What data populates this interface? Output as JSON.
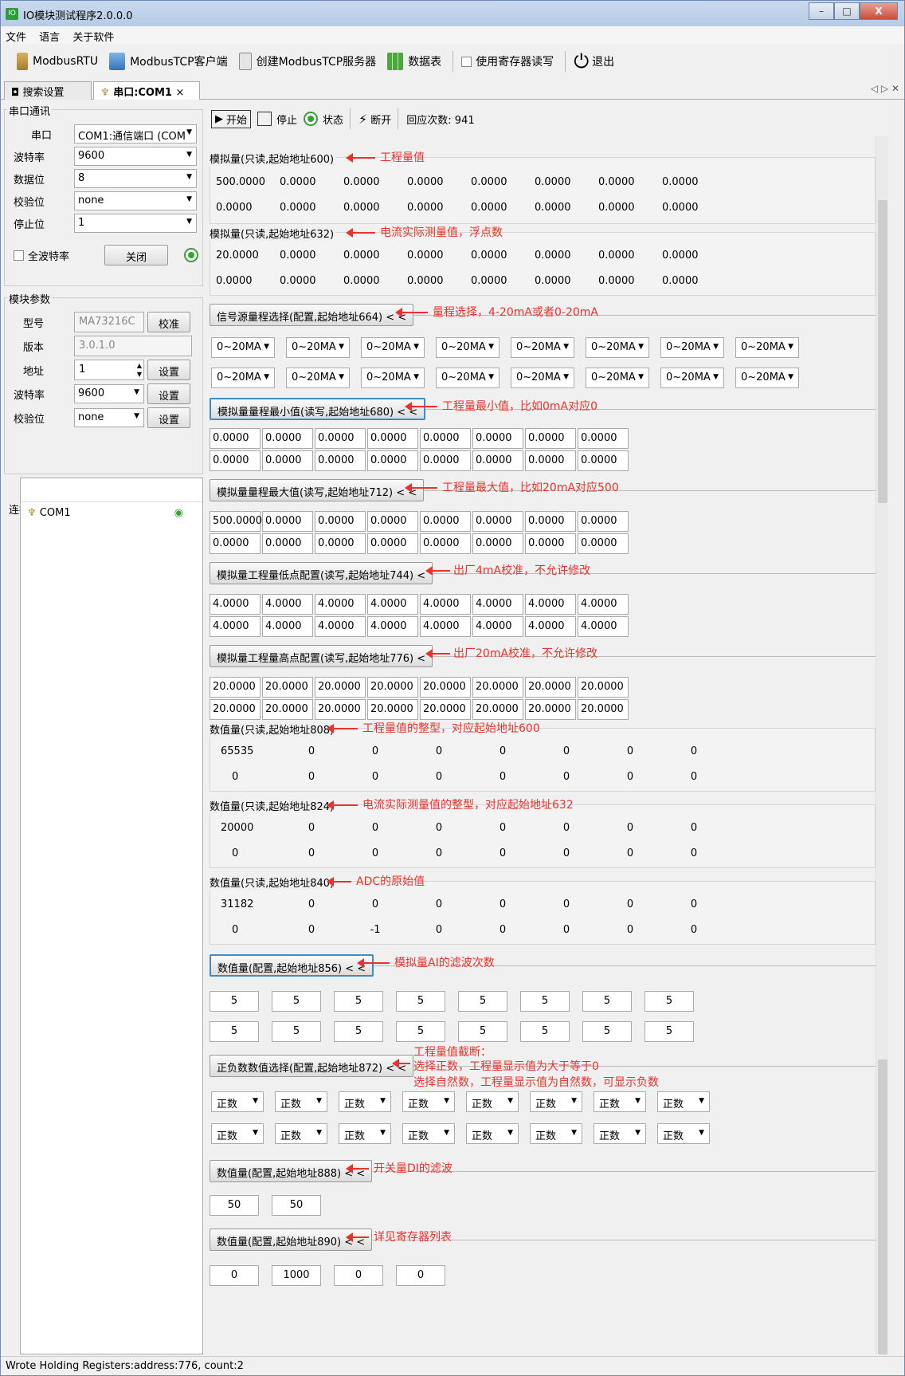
{
  "window": {
    "title": "IO模块测试程序2.0.0.0",
    "controls": [
      "–",
      "□",
      "X"
    ]
  },
  "menu": [
    "文件",
    "语言",
    "关于软件"
  ],
  "toolbar": {
    "modbus_rtu": "ModbusRTU",
    "modbus_tcp_client": "ModbusTCP客户端",
    "create_tcp_server": "创建ModbusTCP服务器",
    "data_table": "数据表",
    "use_register_rw": "使用寄存器读写",
    "exit": "退出"
  },
  "tabs": {
    "search": "搜索设置",
    "com1": "串口:COM1",
    "close": "×",
    "nav": "◁ ▷ ✕"
  },
  "serial": {
    "group_label": "串口通讯",
    "port_label": "串口",
    "port_value": "COM1:通信端口 (COM",
    "baud_label": "波特率",
    "baud_value": "9600",
    "databits_label": "数据位",
    "databits_value": "8",
    "parity_label": "校验位",
    "parity_value": "none",
    "stopbits_label": "停止位",
    "stopbits_value": "1",
    "all_baud_label": "全波特率",
    "close_button": "关闭"
  },
  "module": {
    "group_label": "模块参数",
    "model_label": "型号",
    "model_value": "MA73216C",
    "calibrate_button": "校准",
    "version_label": "版本",
    "version_value": "3.0.1.0",
    "address_label": "地址",
    "address_value": "1",
    "set_button": "设置",
    "baud_label": "波特率",
    "baud_value": "9600",
    "parity_label": "校验位",
    "parity_value": "none"
  },
  "connections": {
    "label": "连接列表",
    "items": [
      "COM1"
    ]
  },
  "run": {
    "start": "开始",
    "stop": "停止",
    "status": "状态",
    "disconnect": "断开",
    "response_count": "回应次数: 941"
  },
  "sections": {
    "s600": {
      "title": "模拟量(只读,起始地址600)",
      "note": "工程量值",
      "row1": [
        "500.0000",
        "0.0000",
        "0.0000",
        "0.0000",
        "0.0000",
        "0.0000",
        "0.0000",
        "0.0000"
      ],
      "row2": [
        "0.0000",
        "0.0000",
        "0.0000",
        "0.0000",
        "0.0000",
        "0.0000",
        "0.0000",
        "0.0000"
      ]
    },
    "s632": {
      "title": "模拟量(只读,起始地址632)",
      "note": "电流实际测量值，浮点数",
      "row1": [
        "20.0000",
        "0.0000",
        "0.0000",
        "0.0000",
        "0.0000",
        "0.0000",
        "0.0000",
        "0.0000"
      ],
      "row2": [
        "0.0000",
        "0.0000",
        "0.0000",
        "0.0000",
        "0.0000",
        "0.0000",
        "0.0000",
        "0.0000"
      ]
    },
    "s664": {
      "title": "信号源量程选择(配置,起始地址664) < <",
      "note": "量程选择，4-20mA或者0-20mA",
      "row1": [
        "0~20MA",
        "0~20MA",
        "0~20MA",
        "0~20MA",
        "0~20MA",
        "0~20MA",
        "0~20MA",
        "0~20MA"
      ],
      "row2": [
        "0~20MA",
        "0~20MA",
        "0~20MA",
        "0~20MA",
        "0~20MA",
        "0~20MA",
        "0~20MA",
        "0~20MA"
      ]
    },
    "s680": {
      "title": "模拟量量程最小值(读写,起始地址680) < <",
      "note": "工程量最小值，比如0mA对应0",
      "row1": [
        "0.0000",
        "0.0000",
        "0.0000",
        "0.0000",
        "0.0000",
        "0.0000",
        "0.0000",
        "0.0000"
      ],
      "row2": [
        "0.0000",
        "0.0000",
        "0.0000",
        "0.0000",
        "0.0000",
        "0.0000",
        "0.0000",
        "0.0000"
      ]
    },
    "s712": {
      "title": "模拟量量程最大值(读写,起始地址712) < <",
      "note": "工程量最大值，比如20mA对应500",
      "row1": [
        "500.0000",
        "0.0000",
        "0.0000",
        "0.0000",
        "0.0000",
        "0.0000",
        "0.0000",
        "0.0000"
      ],
      "row2": [
        "0.0000",
        "0.0000",
        "0.0000",
        "0.0000",
        "0.0000",
        "0.0000",
        "0.0000",
        "0.0000"
      ]
    },
    "s744": {
      "title": "模拟量工程量低点配置(读写,起始地址744) <",
      "note": "出厂4mA校准，不允许修改",
      "row1": [
        "4.0000",
        "4.0000",
        "4.0000",
        "4.0000",
        "4.0000",
        "4.0000",
        "4.0000",
        "4.0000"
      ],
      "row2": [
        "4.0000",
        "4.0000",
        "4.0000",
        "4.0000",
        "4.0000",
        "4.0000",
        "4.0000",
        "4.0000"
      ]
    },
    "s776": {
      "title": "模拟量工程量高点配置(读写,起始地址776) <",
      "note": "出厂20mA校准，不允许修改",
      "row1": [
        "20.0000",
        "20.0000",
        "20.0000",
        "20.0000",
        "20.0000",
        "20.0000",
        "20.0000",
        "20.0000"
      ],
      "row2": [
        "20.0000",
        "20.0000",
        "20.0000",
        "20.0000",
        "20.0000",
        "20.0000",
        "20.0000",
        "20.0000"
      ]
    },
    "s808": {
      "title": "数值量(只读,起始地址808)",
      "note": "工程量值的整型，对应起始地址600",
      "row1": [
        "65535",
        "0",
        "0",
        "0",
        "0",
        "0",
        "0",
        "0"
      ],
      "row2": [
        "0",
        "0",
        "0",
        "0",
        "0",
        "0",
        "0",
        "0"
      ]
    },
    "s824": {
      "title": "数值量(只读,起始地址824)",
      "note": "电流实际测量值的整型，对应起始地址632",
      "row1": [
        "20000",
        "0",
        "0",
        "0",
        "0",
        "0",
        "0",
        "0"
      ],
      "row2": [
        "0",
        "0",
        "0",
        "0",
        "0",
        "0",
        "0",
        "0"
      ]
    },
    "s840": {
      "title": "数值量(只读,起始地址840)",
      "note": "ADC的原始值",
      "row1": [
        "31182",
        "0",
        "0",
        "0",
        "0",
        "0",
        "0",
        "0"
      ],
      "row2": [
        "0",
        "0",
        "-1",
        "0",
        "0",
        "0",
        "0",
        "0"
      ]
    },
    "s856": {
      "title": "数值量(配置,起始地址856) < <",
      "note": "模拟量AI的滤波次数",
      "row1": [
        "5",
        "5",
        "5",
        "5",
        "5",
        "5",
        "5",
        "5"
      ],
      "row2": [
        "5",
        "5",
        "5",
        "5",
        "5",
        "5",
        "5",
        "5"
      ]
    },
    "s872": {
      "title": "正负数数值选择(配置,起始地址872) < <",
      "note1": "工程量值截断：",
      "note2": "选择正数，工程量显示值为大于等于0",
      "note3": "选择自然数，工程量显示值为自然数，可显示负数",
      "row1": [
        "正数",
        "正数",
        "正数",
        "正数",
        "正数",
        "正数",
        "正数",
        "正数"
      ],
      "row2": [
        "正数",
        "正数",
        "正数",
        "正数",
        "正数",
        "正数",
        "正数",
        "正数"
      ]
    },
    "s888": {
      "title": "数值量(配置,起始地址888) < <",
      "note": "开关量DI的滤波",
      "row1": [
        "50",
        "50"
      ]
    },
    "s890": {
      "title": "数值量(配置,起始地址890) < <",
      "note": "详见寄存器列表",
      "row1": [
        "0",
        "1000",
        "0",
        "0"
      ]
    }
  },
  "status_bar": "Wrote Holding Registers:address:776, count:2",
  "colors": {
    "annotation": "#e8322b",
    "accent": "#3c8dc5",
    "ok_green": "#2fa82f"
  }
}
